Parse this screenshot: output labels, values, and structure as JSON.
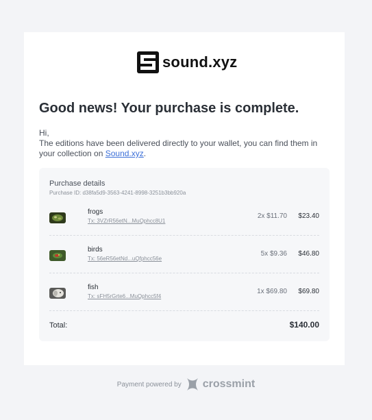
{
  "brand": {
    "name": "sound.xyz"
  },
  "headline": "Good news! Your purchase is complete.",
  "intro": {
    "greeting": "Hi,",
    "message": "The editions have been delivered directly to your wallet, you can find them in your collection on ",
    "link_text": "Sound.xyz",
    "suffix": "."
  },
  "purchase": {
    "title": "Purchase details",
    "id_label": "Purchase ID: d38fa5d9-3563-4241-8998-3251b3bb920a",
    "items": [
      {
        "name": "frogs",
        "tx": "Tx: 3VZrR56etN...MuQphcc8U1",
        "qty_price": "2x $11.70",
        "total": "$23.40",
        "thumb_icon": "frog-thumbnail"
      },
      {
        "name": "birds",
        "tx": "Tx: 56eR56etNd...uQfphcc56e",
        "qty_price": "5x $9.36",
        "total": "$46.80",
        "thumb_icon": "bird-thumbnail"
      },
      {
        "name": "fish",
        "tx": "Tx: sFH5rGrte6...MuQphcc5f4",
        "qty_price": "1x $69.80",
        "total": "$69.80",
        "thumb_icon": "fish-thumbnail"
      }
    ],
    "total_label": "Total:",
    "total_value": "$140.00"
  },
  "footer": {
    "text": "Payment powered by",
    "brand": "crossmint"
  },
  "colors": {
    "background": "#f3f4f7",
    "card": "#ffffff",
    "panel": "#f6f7f9",
    "link": "#3b6fd8"
  }
}
